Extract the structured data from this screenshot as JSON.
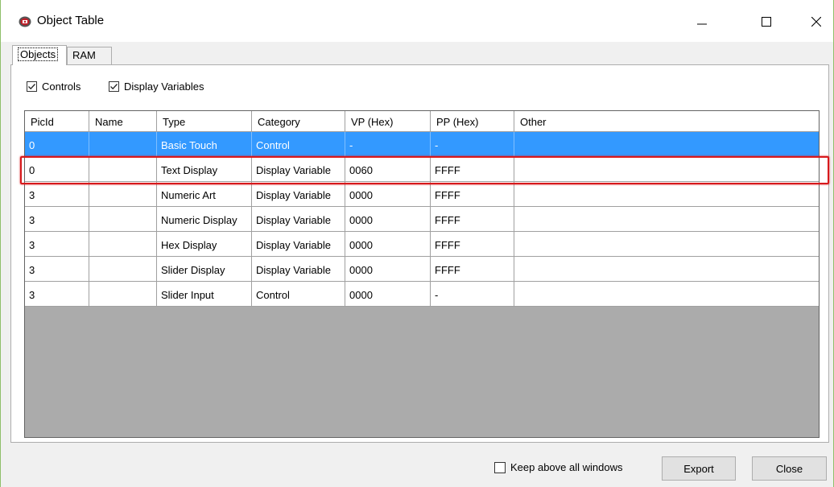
{
  "window": {
    "title": "Object Table",
    "minimize_glyph": "—",
    "maximize_glyph": "☐",
    "close_glyph": "✕",
    "icon": "app-record-icon"
  },
  "tabs": [
    {
      "label": "Objects",
      "selected": true
    },
    {
      "label": "RAM",
      "selected": false
    }
  ],
  "filters": {
    "controls": {
      "label": "Controls",
      "checked": true
    },
    "display_variables": {
      "label": "Display Variables",
      "checked": true
    }
  },
  "table": {
    "columns": [
      "PicId",
      "Name",
      "Type",
      "Category",
      "VP (Hex)",
      "PP (Hex)",
      "Other"
    ],
    "rows": [
      {
        "picid": "0",
        "name": "",
        "type": "Basic Touch",
        "category": "Control",
        "vp": "-",
        "pp": "-",
        "other": "",
        "selected": true
      },
      {
        "picid": "0",
        "name": "",
        "type": "Text Display",
        "category": "Display Variable",
        "vp": "0060",
        "pp": "FFFF",
        "other": "",
        "highlighted": true
      },
      {
        "picid": "3",
        "name": "",
        "type": "Numeric Art",
        "category": "Display Variable",
        "vp": "0000",
        "pp": "FFFF",
        "other": ""
      },
      {
        "picid": "3",
        "name": "",
        "type": "Numeric Display",
        "category": "Display Variable",
        "vp": "0000",
        "pp": "FFFF",
        "other": ""
      },
      {
        "picid": "3",
        "name": "",
        "type": "Hex Display",
        "category": "Display Variable",
        "vp": "0000",
        "pp": "FFFF",
        "other": ""
      },
      {
        "picid": "3",
        "name": "",
        "type": "Slider Display",
        "category": "Display Variable",
        "vp": "0000",
        "pp": "FFFF",
        "other": ""
      },
      {
        "picid": "3",
        "name": "",
        "type": "Slider Input",
        "category": "Control",
        "vp": "0000",
        "pp": "-",
        "other": ""
      }
    ]
  },
  "footer": {
    "keep_above": {
      "label": "Keep above all windows",
      "checked": false
    },
    "export_label": "Export",
    "close_label": "Close"
  },
  "colors": {
    "selection": "#3399ff",
    "highlight_border": "#d7191c",
    "empty_grid": "#ababab"
  }
}
